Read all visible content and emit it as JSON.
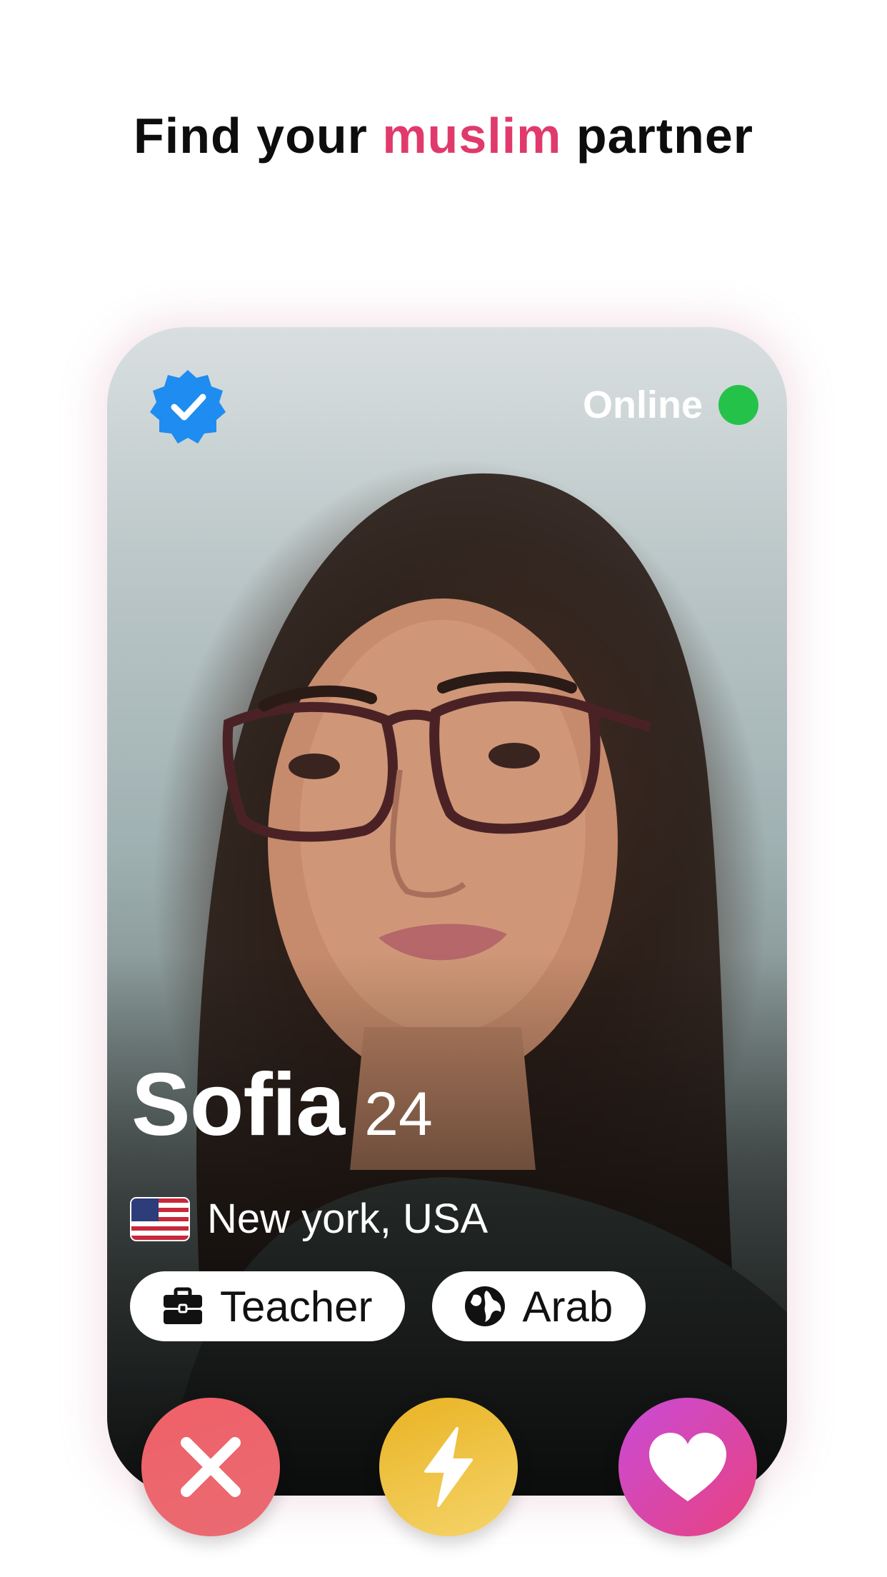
{
  "headline": {
    "before": "Find your",
    "accent": "muslim",
    "after": "partner",
    "accent_color": "#e03a6c"
  },
  "profile": {
    "status": "Online",
    "status_color": "#25c24a",
    "name": "Sofia",
    "age": "24",
    "flag_icon": "us-flag-icon",
    "location": "New york, USA",
    "tags": [
      {
        "icon": "briefcase-icon",
        "label": "Teacher"
      },
      {
        "icon": "globe-icon",
        "label": "Arab"
      }
    ],
    "verified_icon": "verified-badge-icon",
    "verified_color": "#1e8cf0"
  },
  "actions": {
    "pass_icon": "close-icon",
    "boost_icon": "lightning-icon",
    "like_icon": "heart-icon"
  }
}
